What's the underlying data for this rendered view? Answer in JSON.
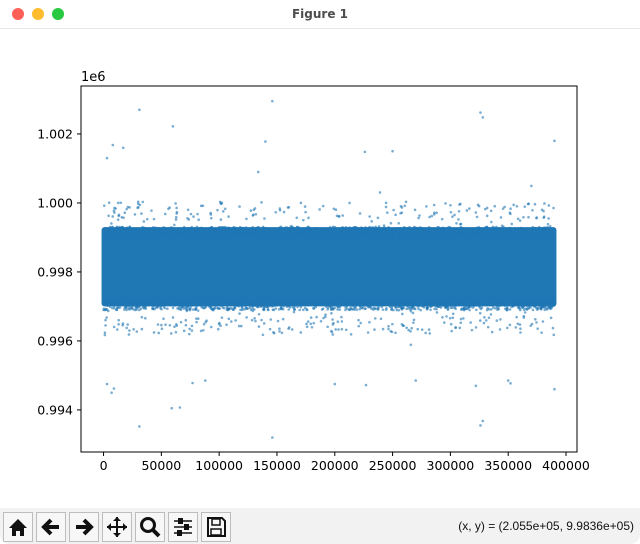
{
  "window": {
    "title": "Figure 1"
  },
  "toolbar": {
    "buttons": [
      {
        "name": "home",
        "icon": "home-icon"
      },
      {
        "name": "back",
        "icon": "arrow-left-icon"
      },
      {
        "name": "forward",
        "icon": "arrow-right-icon"
      },
      {
        "name": "pan",
        "icon": "move-icon"
      },
      {
        "name": "zoom",
        "icon": "magnifier-icon"
      },
      {
        "name": "configure-subplots",
        "icon": "sliders-icon"
      },
      {
        "name": "save",
        "icon": "floppy-disk-icon"
      }
    ],
    "coords": "(x, y) = (2.055e+05, 9.9836e+05)"
  },
  "colors": {
    "marker": "#1f77b4"
  },
  "chart_data": {
    "type": "scatter",
    "title": "",
    "xlabel": "",
    "ylabel": "",
    "y_offset_label": "1e6",
    "xlim": [
      -19500,
      409500
    ],
    "ylim": [
      0.99278,
      1.00339
    ],
    "xticks": [
      0,
      50000,
      100000,
      150000,
      200000,
      250000,
      300000,
      350000,
      400000
    ],
    "xtick_labels": [
      "0",
      "50000",
      "100000",
      "150000",
      "200000",
      "250000",
      "300000",
      "350000",
      "400000"
    ],
    "yticks": [
      0.994,
      0.996,
      0.998,
      1.0,
      1.002
    ],
    "ytick_labels": [
      "0.994",
      "0.996",
      "0.998",
      "1.000",
      "1.002"
    ],
    "grid": false,
    "series_summary": {
      "x_range": [
        0,
        390000
      ],
      "center": 0.9981,
      "core_band": [
        0.997,
        0.9993
      ],
      "spread_sd": 0.00055
    },
    "outliers": [
      [
        31000,
        1.0027
      ],
      [
        146000,
        1.00295
      ],
      [
        60000,
        1.00222
      ],
      [
        326000,
        1.00262
      ],
      [
        328000,
        1.00248
      ],
      [
        390000,
        1.0018
      ],
      [
        3000,
        1.0013
      ],
      [
        8000,
        1.00168
      ],
      [
        17000,
        1.0016
      ],
      [
        140000,
        1.00178
      ],
      [
        250000,
        1.0015
      ],
      [
        226000,
        1.00148
      ],
      [
        31000,
        0.99352
      ],
      [
        146000,
        0.9932
      ],
      [
        59000,
        0.99405
      ],
      [
        66000,
        0.99407
      ],
      [
        326000,
        0.99355
      ],
      [
        328000,
        0.99368
      ],
      [
        7000,
        0.9945
      ],
      [
        9000,
        0.99462
      ],
      [
        3000,
        0.99475
      ],
      [
        77000,
        0.99478
      ],
      [
        88000,
        0.99485
      ],
      [
        200000,
        0.99475
      ],
      [
        227000,
        0.99472
      ],
      [
        270000,
        0.99485
      ],
      [
        322000,
        0.9947
      ],
      [
        350000,
        0.99485
      ],
      [
        352000,
        0.99477
      ],
      [
        390000,
        0.9946
      ]
    ]
  }
}
